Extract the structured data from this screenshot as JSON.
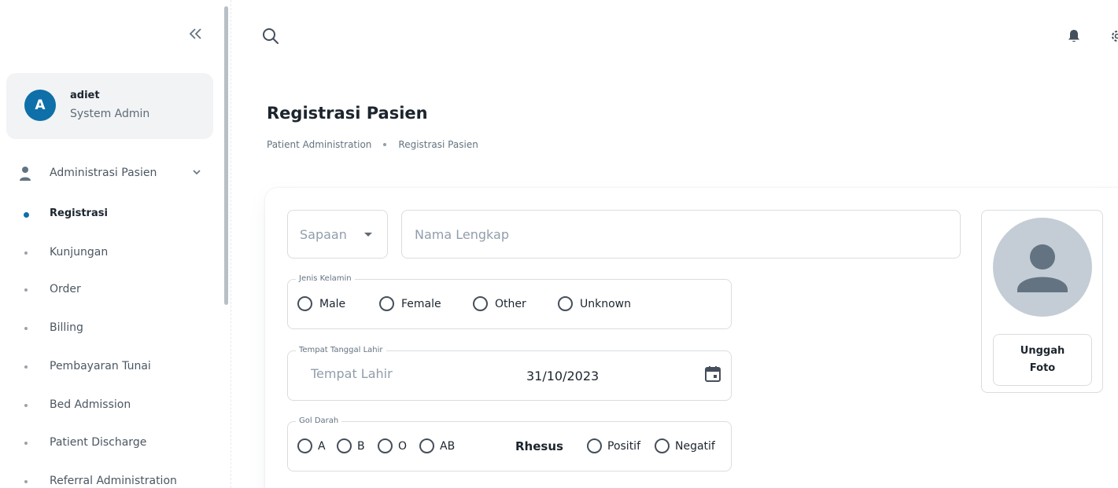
{
  "sidebar": {
    "collapse_icon": "double-chevron-left-icon",
    "user": {
      "initial": "A",
      "name": "adiet",
      "role": "System Admin"
    },
    "group": {
      "icon": "person-icon",
      "label": "Administrasi Pasien",
      "chevron_icon": "chevron-down-icon"
    },
    "items": [
      {
        "label": "Registrasi",
        "active": true
      },
      {
        "label": "Kunjungan"
      },
      {
        "label": "Order"
      },
      {
        "label": "Billing"
      },
      {
        "label": "Pembayaran Tunai"
      },
      {
        "label": "Bed Admission"
      },
      {
        "label": "Patient Discharge"
      },
      {
        "label": "Referral Administration"
      }
    ]
  },
  "topbar": {
    "search_icon": "search-icon",
    "bell_icon": "bell-icon",
    "settings_icon": "gear-icon"
  },
  "page": {
    "title": "Registrasi Pasien",
    "breadcrumb": [
      "Patient Administration",
      "Registrasi Pasien"
    ]
  },
  "form": {
    "sapaan": {
      "value": "Sapaan"
    },
    "nama": {
      "placeholder": "Nama Lengkap",
      "value": ""
    },
    "jenis_kelamin": {
      "legend": "Jenis Kelamin",
      "options": [
        "Male",
        "Female",
        "Other",
        "Unknown"
      ]
    },
    "ttl": {
      "legend": "Tempat Tanggal Lahir",
      "tempat_placeholder": "Tempat Lahir",
      "tanggal": "31/10/2023",
      "calendar_icon": "calendar-icon"
    },
    "gol_darah": {
      "legend": "Gol Darah",
      "options": [
        "A",
        "B",
        "O",
        "AB"
      ],
      "rhesus_label": "Rhesus",
      "rhesus_options": [
        "Positif",
        "Negatif"
      ]
    }
  },
  "photo": {
    "avatar_icon": "person-placeholder-icon",
    "upload_label": "Unggah Foto"
  },
  "colors": {
    "primary": "#0f6fa8",
    "border": "#d9dde1",
    "placeholder": "#919eab"
  }
}
